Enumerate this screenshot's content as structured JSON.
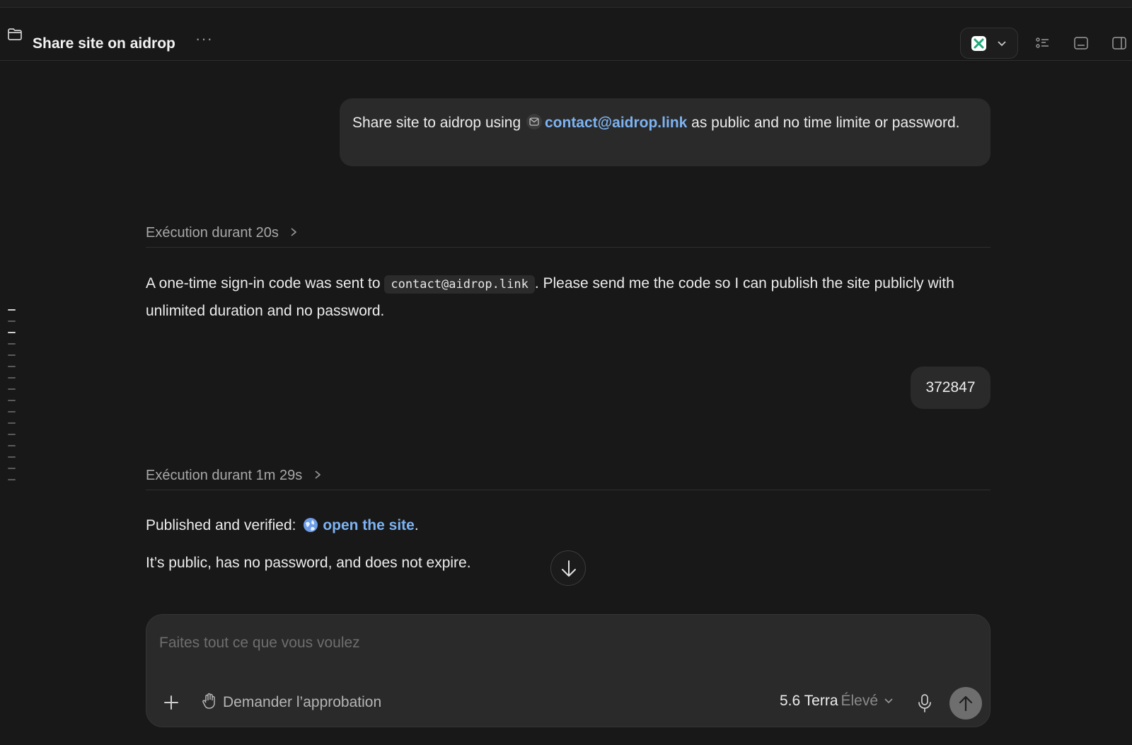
{
  "header": {
    "title": "Share site on aidrop",
    "more_glyph": "···"
  },
  "user_message_1": {
    "before": "Share site to aidrop using ",
    "email_link": "contact@aidrop.link",
    "after": " as public and no time limite or password."
  },
  "exec_1": {
    "label": "Exécution durant 20s"
  },
  "assistant_1": {
    "before": "A one-time sign-in code was sent to ",
    "code": "contact@aidrop.link",
    "after": ". Please send me the code so I can publish the site publicly with unlimited duration and no password."
  },
  "user_message_2": {
    "text": "372847"
  },
  "exec_2": {
    "label": "Exécution durant 1m 29s"
  },
  "assistant_2": {
    "line1_before": "Published and verified: ",
    "link": "open the site",
    "line1_after": ".",
    "line2": "It’s public, has no password, and does not expire."
  },
  "composer": {
    "placeholder": "Faites tout ce que vous voulez",
    "approval_label": "Demander l’approbation",
    "model_name": "5.6 Terra",
    "model_level": "Élevé"
  },
  "icons": {
    "folder": "folder-icon",
    "more": "more-icon",
    "app": "app-logo-icon",
    "list": "list-icon",
    "terminal": "terminal-icon",
    "panel": "panel-toggle-icon",
    "mail": "mail-icon",
    "globe": "globe-icon",
    "arrow_down": "arrow-down-icon",
    "plus": "plus-icon",
    "hand": "hand-icon",
    "mic": "mic-icon",
    "send": "arrow-up-icon"
  },
  "colors": {
    "background": "#181818",
    "bubble": "#2a2a2a",
    "link": "#7db3f2",
    "app_accent": "#1fa97a"
  }
}
